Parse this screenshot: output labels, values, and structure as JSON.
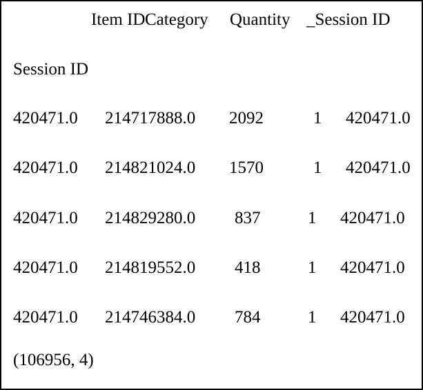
{
  "output": {
    "type": "pandas-dataframe-repr",
    "index_name": "Session ID",
    "columns": [
      "Item ID",
      "Category",
      "Quantity",
      "_Session ID"
    ],
    "rows": [
      {
        "index": "420471.0",
        "item_id": "214717888.0",
        "quantity": "2092",
        "category": "1",
        "session_id": "420471.0"
      },
      {
        "index": "420471.0",
        "item_id": "214821024.0",
        "quantity": "1570",
        "category": "1",
        "session_id": "420471.0"
      },
      {
        "index": "420471.0",
        "item_id": "214829280.0",
        "quantity": "837",
        "category": "1",
        "session_id": "420471.0"
      },
      {
        "index": "420471.0",
        "item_id": "214819552.0",
        "quantity": "418",
        "category": "1",
        "session_id": "420471.0"
      },
      {
        "index": "420471.0",
        "item_id": "214746384.0",
        "quantity": "784",
        "category": "1",
        "session_id": "420471.0"
      }
    ],
    "shape_text": "(106956, 4)",
    "shape": {
      "rows": 106956,
      "columns": 4
    }
  },
  "style": {
    "background": "#ffffff",
    "text_color": "#000000",
    "border_color": "#000000"
  }
}
